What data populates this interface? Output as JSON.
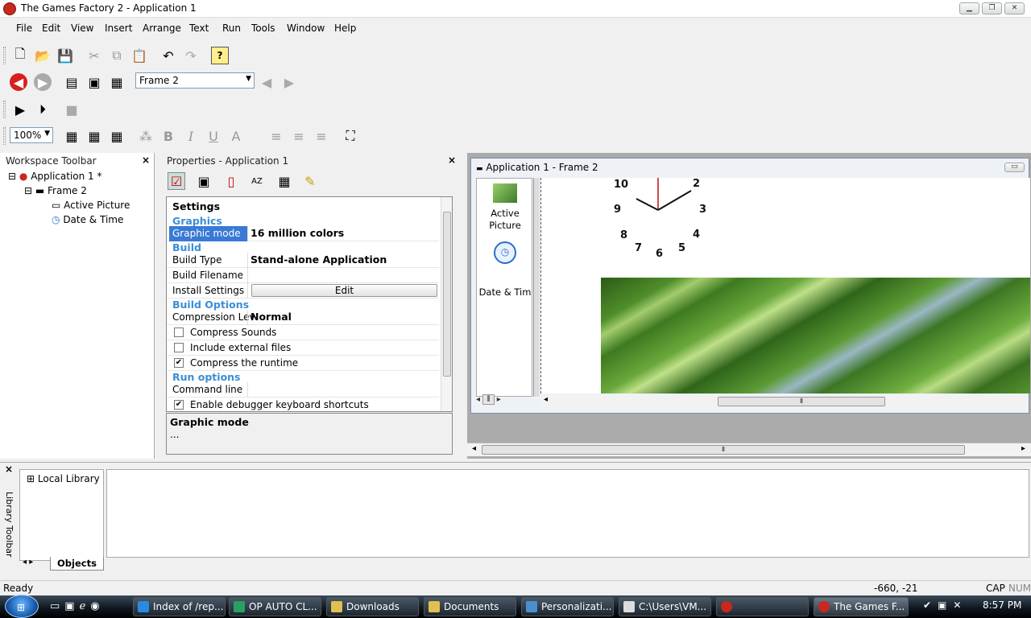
{
  "window": {
    "title": "The Games Factory 2 - Application 1"
  },
  "menu": [
    "File",
    "Edit",
    "View",
    "Insert",
    "Arrange",
    "Text",
    "Run",
    "Tools",
    "Window",
    "Help"
  ],
  "toolbar": {
    "frame_select": "Frame 2",
    "zoom": "100%"
  },
  "workspace": {
    "title": "Workspace Toolbar",
    "app": "Application 1 *",
    "frame": "Frame 2",
    "objects": [
      "Active Picture",
      "Date & Time"
    ]
  },
  "properties": {
    "title": "Properties - Application 1",
    "header": "Settings",
    "cat_graphics": "Graphics",
    "graphic_mode_label": "Graphic mode",
    "graphic_mode_value": "16 million colors",
    "cat_build": "Build",
    "build_type_label": "Build Type",
    "build_type_value": "Stand-alone Application",
    "build_filename_label": "Build Filename",
    "install_settings_label": "Install Settings",
    "edit_button": "Edit",
    "cat_build_options": "Build Options",
    "compression_label": "Compression Lev",
    "compression_value": "Normal",
    "compress_sounds": "Compress Sounds",
    "include_external": "Include external files",
    "compress_runtime": "Compress the runtime",
    "cat_run_options": "Run options",
    "command_line_label": "Command line",
    "enable_debugger": "Enable debugger keyboard shortcuts",
    "desc_title": "Graphic mode",
    "desc_text": "..."
  },
  "frame_editor": {
    "title": "Application 1 - Frame 2",
    "palette": [
      "Active\nPicture",
      "Date & Tim"
    ],
    "clock_numbers": [
      "10",
      "2",
      "9",
      "3",
      "8",
      "4",
      "7",
      "6",
      "5"
    ]
  },
  "library": {
    "side_label": "Library Toolbar",
    "tree_item": "Local Library",
    "tab": "Objects"
  },
  "status": {
    "text": "Ready",
    "coords": "-660, -21",
    "cap": "CAP",
    "num": "NUM"
  },
  "taskbar": {
    "items": [
      "Index of /rep...",
      "OP AUTO CL...",
      "Downloads",
      "Documents",
      "Personalizati...",
      "C:\\Users\\VM...",
      "",
      "The Games F..."
    ],
    "time": "8:57 PM"
  }
}
